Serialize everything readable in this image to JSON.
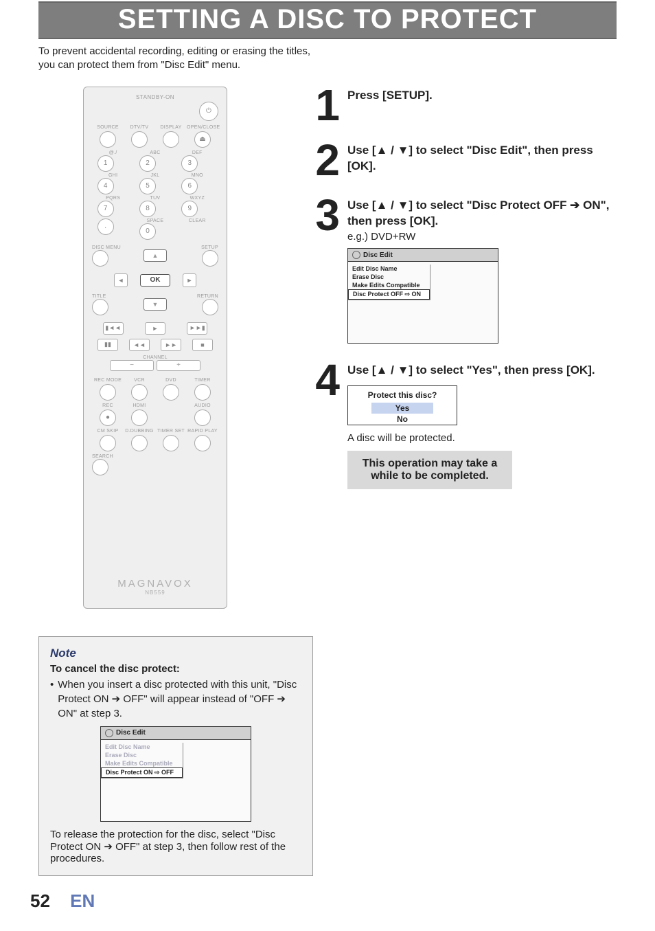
{
  "title": "SETTING A DISC TO PROTECT",
  "intro": "To prevent accidental recording, editing or erasing the titles, you can protect them from \"Disc Edit\" menu.",
  "remote": {
    "standby": "STANDBY-ON",
    "row1": [
      "SOURCE",
      "DTV/TV",
      "DISPLAY",
      "OPEN/CLOSE"
    ],
    "keypad_top": [
      "@./",
      "ABC",
      "DEF"
    ],
    "keypad": [
      "1",
      "2",
      "3",
      "4",
      "5",
      "6",
      "7",
      "8",
      "9",
      ".",
      "0",
      ""
    ],
    "keypad_lbl": [
      "GHI",
      "JKL",
      "MNO",
      "PQRS",
      "TUV",
      "WXYZ",
      "",
      "SPACE",
      "CLEAR"
    ],
    "discmenu": "DISC MENU",
    "setup": "SETUP",
    "ok": "OK",
    "title_l": "TITLE",
    "return_l": "RETURN",
    "channel": "CHANNEL",
    "row2": [
      "REC MODE",
      "VCR",
      "DVD",
      "TIMER"
    ],
    "row3": [
      "REC",
      "HDMI",
      "",
      "AUDIO"
    ],
    "row4": [
      "CM SKIP",
      "D.DUBBING",
      "TIMER SET",
      "RAPID PLAY"
    ],
    "search": "SEARCH",
    "brand": "MAGNAVOX",
    "model": "NB559"
  },
  "steps": [
    {
      "num": "1",
      "heading": "Press [SETUP]."
    },
    {
      "num": "2",
      "heading": "Use [▲ / ▼] to select \"Disc Edit\", then press [OK]."
    },
    {
      "num": "3",
      "heading": "Use [▲ / ▼] to select \"Disc Protect OFF ➔ ON\", then press [OK].",
      "sub": "e.g.) DVD+RW",
      "box": {
        "title": "Disc Edit",
        "items": [
          "Edit Disc Name",
          "Erase Disc",
          "Make Edits Compatible",
          "Disc Protect OFF ⇨ ON"
        ],
        "sel": 3
      }
    },
    {
      "num": "4",
      "heading": "Use [▲ / ▼] to select \"Yes\", then press [OK].",
      "confirm": {
        "q": "Protect this disc?",
        "yes": "Yes",
        "no": "No"
      },
      "result": "A disc will be protected.",
      "warn": "This operation may take a while to be completed."
    }
  ],
  "note": {
    "title": "Note",
    "sub": "To cancel the disc protect:",
    "li": "When you insert a disc protected with this unit, \"Disc Protect ON ➔ OFF\" will appear instead of \"OFF ➔ ON\" at step 3.",
    "box": {
      "title": "Disc Edit",
      "items": [
        "Edit Disc Name",
        "Erase Disc",
        "Make Edits Compatible",
        "Disc Protect ON ⇨ OFF"
      ],
      "sel": 3,
      "dim": true
    },
    "after": "To release the protection for the disc, select \"Disc Protect ON ➔ OFF\" at step 3, then follow rest of the procedures."
  },
  "footer": {
    "page": "52",
    "lang": "EN"
  }
}
